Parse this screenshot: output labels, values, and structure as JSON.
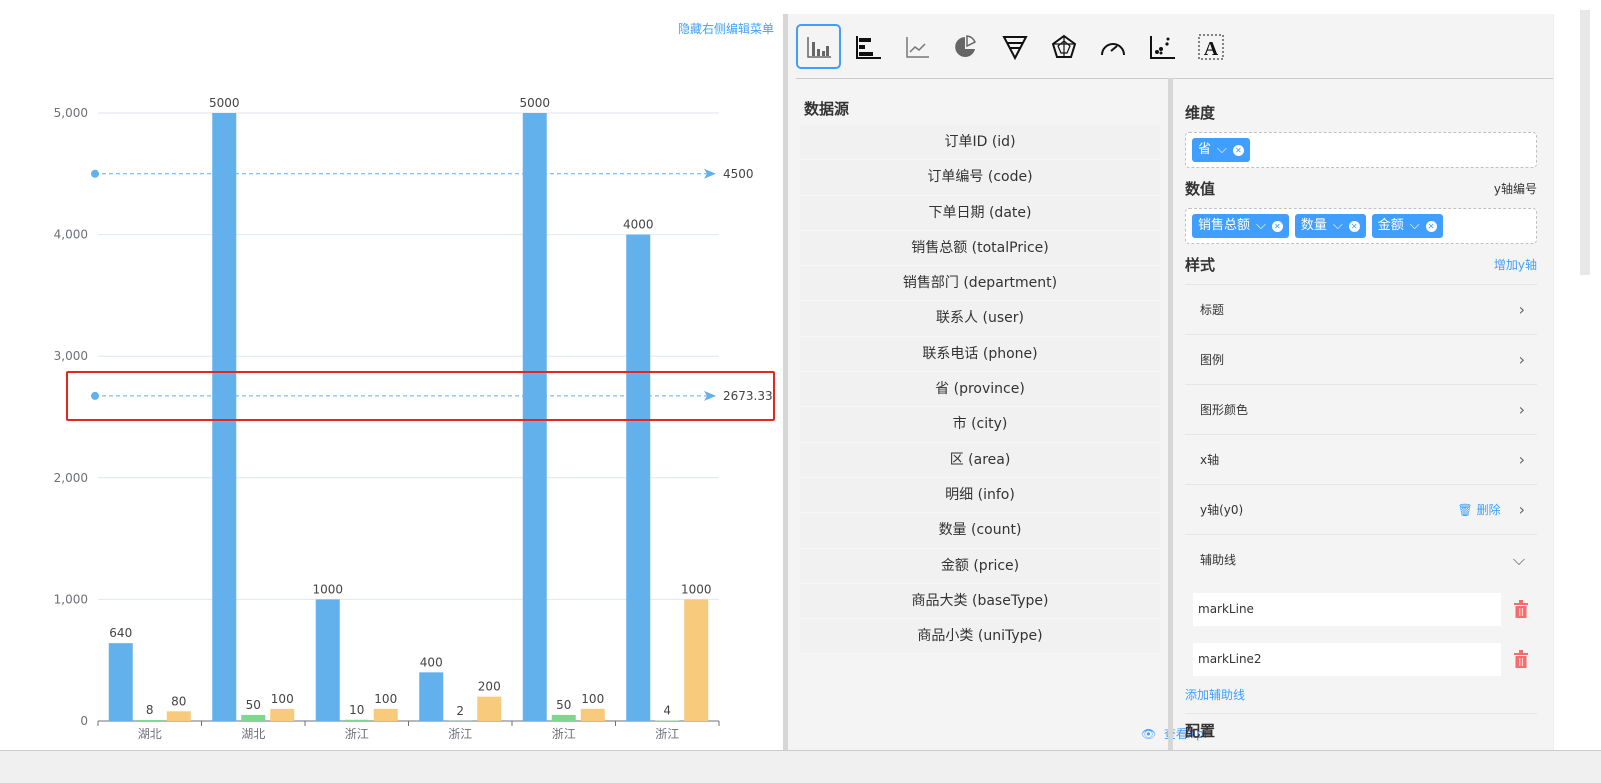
{
  "chart": {
    "hide_menu_link": "隐藏右侧编辑菜单",
    "chart_data": {
      "type": "bar",
      "categories": [
        "湖北",
        "湖北",
        "浙江",
        "浙江",
        "浙江",
        "浙江"
      ],
      "series": [
        {
          "values": [
            640,
            5000,
            1000,
            400,
            5000,
            4000
          ],
          "color": "#62b0ec"
        },
        {
          "values": [
            8,
            50,
            10,
            2,
            50,
            4
          ],
          "color": "#7bd88d"
        },
        {
          "values": [
            80,
            100,
            100,
            200,
            100,
            1000
          ],
          "color": "#f8ca7c"
        }
      ],
      "ylim": [
        0,
        5000
      ],
      "yticks": [
        "0",
        "1,000",
        "2,000",
        "3,000",
        "4,000",
        "5,000"
      ],
      "grid": true,
      "mark_lines": [
        {
          "value": 4500,
          "label": "4500"
        },
        {
          "value": 2673.33,
          "label": "2673.33"
        }
      ],
      "data_labels": true
    }
  },
  "toolbar": {
    "icons": [
      "bar-chart",
      "horizontal-bar-chart",
      "line-chart",
      "pie-chart",
      "funnel-chart",
      "radar-chart",
      "gauge-chart",
      "scatter-chart",
      "text-widget"
    ],
    "active": 0
  },
  "datasource": {
    "title": "数据源",
    "items": [
      "订单ID (id)",
      "订单编号 (code)",
      "下单日期 (date)",
      "销售总额 (totalPrice)",
      "销售部门 (department)",
      "联系人 (user)",
      "联系电话 (phone)",
      "省 (province)",
      "市 (city)",
      "区 (area)",
      "明细 (info)",
      "数量 (count)",
      "金额 (price)",
      "商品大类 (baseType)",
      "商品小类 (uniType)"
    ],
    "view_api": "查看Api"
  },
  "config": {
    "dimension_title": "维度",
    "dimension_tags": [
      "省"
    ],
    "value_title": "数值",
    "yaxis_no": "y轴编号",
    "value_tags": [
      "销售总额",
      "数量",
      "金额"
    ],
    "style_title": "样式",
    "add_yaxis": "增加y轴",
    "rows": [
      "标题",
      "图例",
      "图形颜色",
      "x轴",
      "y轴(y0)",
      "辅助线"
    ],
    "delete_label": "删除",
    "marklines": [
      "markLine",
      "markLine2"
    ],
    "add_markline": "添加辅助线",
    "setting_title": "配置"
  },
  "colors": {
    "accent": "#409eff",
    "highlight": "#e5261c",
    "danger": "#f56c6c"
  }
}
